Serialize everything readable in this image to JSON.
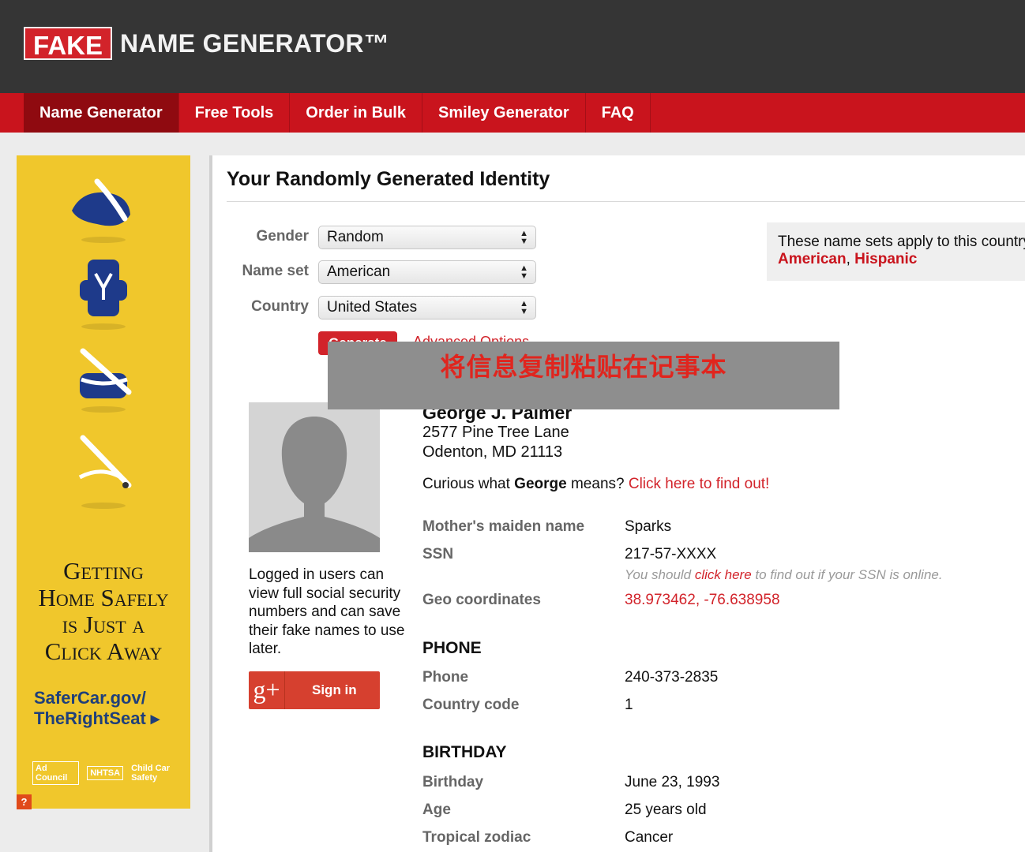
{
  "header": {
    "logo_fake": "FAKE",
    "logo_rest": "NAME GENERATOR™"
  },
  "nav": {
    "items": [
      {
        "label": "Name Generator"
      },
      {
        "label": "Free Tools"
      },
      {
        "label": "Order in Bulk"
      },
      {
        "label": "Smiley Generator"
      },
      {
        "label": "FAQ"
      }
    ]
  },
  "ad": {
    "headline_1": "Getting",
    "headline_2": "Home Safely",
    "headline_3": "is Just a",
    "headline_4": "Click Away",
    "link_1": "SaferCar.gov/",
    "link_2": "TheRightSeat ▸",
    "logo_1": "Ad Council",
    "logo_2": "NHTSA",
    "logo_3": "Child Car Safety",
    "help": "?"
  },
  "main": {
    "title": "Your Randomly Generated Identity",
    "form": {
      "gender_label": "Gender",
      "gender_value": "Random",
      "nameset_label": "Name set",
      "nameset_value": "American",
      "country_label": "Country",
      "country_value": "United States",
      "generate_label": "Generate",
      "advanced_label": "Advanced Options"
    },
    "sets_box": {
      "text": "These name sets apply to this country:",
      "set_1": "American",
      "sep": ", ",
      "set_2": "Hispanic"
    },
    "overlay_text": "将信息复制粘贴在记事本",
    "login_text": "Logged in users can view full social security numbers and can save their fake names to use later.",
    "signin_icon": "g+",
    "signin_label": "Sign in",
    "identity": {
      "name": "George J. Palmer",
      "street": "2577 Pine Tree Lane",
      "city": "Odenton, MD 21113",
      "curious_pre": "Curious what ",
      "curious_name": "George",
      "curious_mid": " means? ",
      "curious_link": "Click here to find out!",
      "maiden_label": "Mother's maiden name",
      "maiden_value": "Sparks",
      "ssn_label": "SSN",
      "ssn_value": "217-57-XXXX",
      "ssn_note_pre": "You should ",
      "ssn_note_link": "click here",
      "ssn_note_post": " to find out if your SSN is online.",
      "geo_label": "Geo coordinates",
      "geo_value": "38.973462, -76.638958"
    },
    "phone": {
      "heading": "PHONE",
      "phone_label": "Phone",
      "phone_value": "240-373-2835",
      "cc_label": "Country code",
      "cc_value": "1"
    },
    "birthday": {
      "heading": "BIRTHDAY",
      "birthday_label": "Birthday",
      "birthday_value": "June 23, 1993",
      "age_label": "Age",
      "age_value": "25 years old",
      "zodiac_label": "Tropical zodiac",
      "zodiac_value": "Cancer"
    }
  },
  "colors": {
    "brand_red": "#c9141d",
    "header_dark": "#353535",
    "ad_yellow": "#f0c72c"
  }
}
